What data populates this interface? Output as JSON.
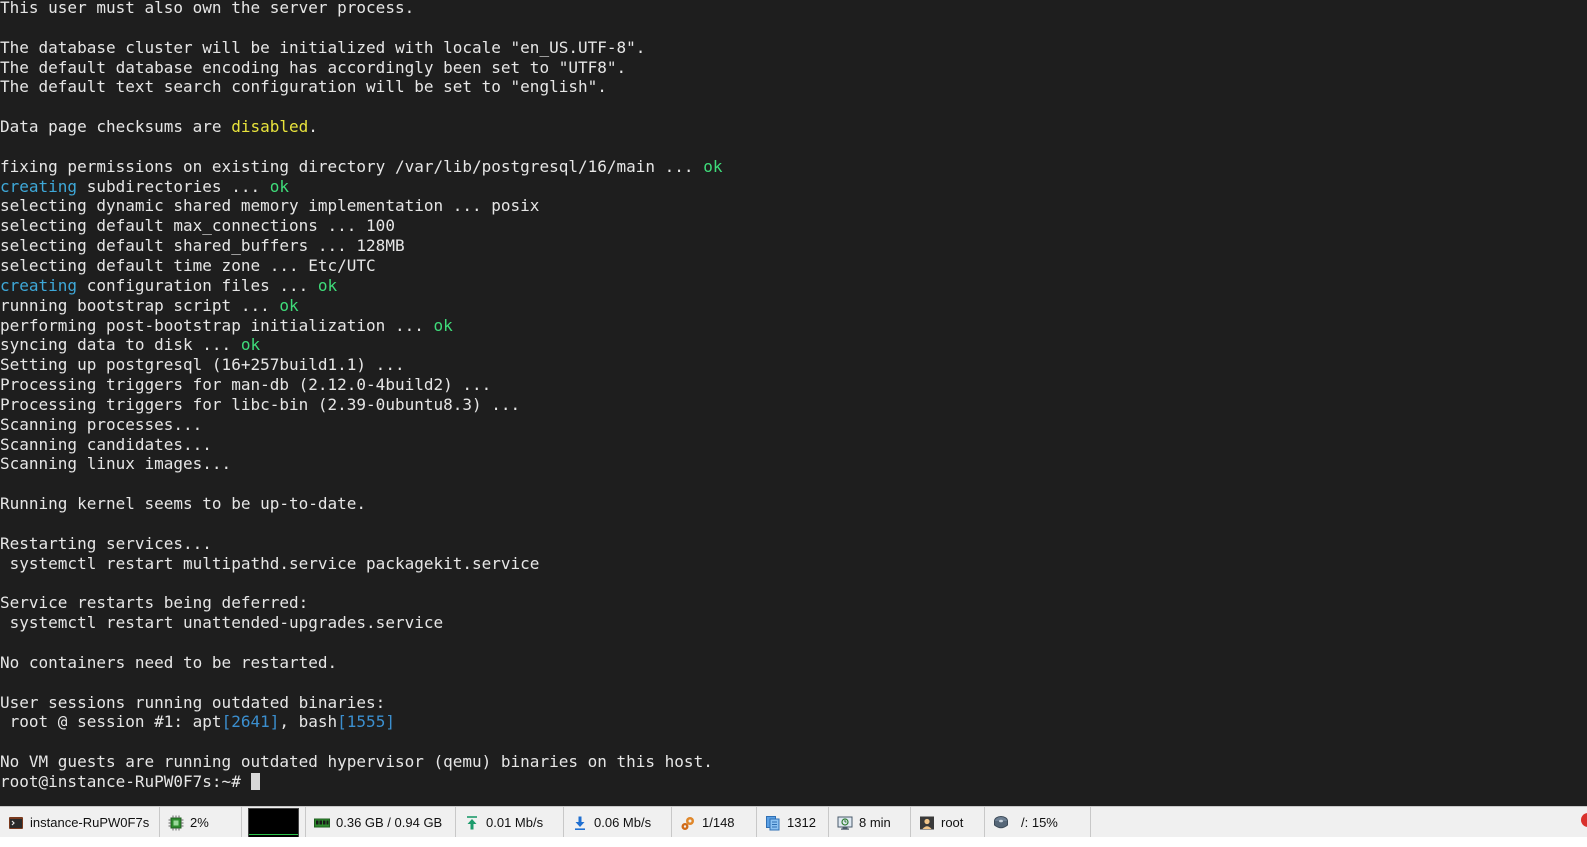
{
  "terminal": {
    "lines": [
      [
        {
          "t": "This user must also own the server process."
        }
      ],
      [
        {
          "t": ""
        }
      ],
      [
        {
          "t": "The database cluster will be initialized with locale \"en_US.UTF-8\"."
        }
      ],
      [
        {
          "t": "The default database encoding has accordingly been set to \"UTF8\"."
        }
      ],
      [
        {
          "t": "The default text search configuration will be set to \"english\"."
        }
      ],
      [
        {
          "t": ""
        }
      ],
      [
        {
          "t": "Data page checksums are "
        },
        {
          "t": "disabled",
          "c": "yellow"
        },
        {
          "t": "."
        }
      ],
      [
        {
          "t": ""
        }
      ],
      [
        {
          "t": "fixing permissions on existing directory /var/lib/postgresql/16/main ... "
        },
        {
          "t": "ok",
          "c": "green"
        }
      ],
      [
        {
          "t": "creating",
          "c": "cyan"
        },
        {
          "t": " subdirectories ... "
        },
        {
          "t": "ok",
          "c": "green"
        }
      ],
      [
        {
          "t": "selecting dynamic shared memory implementation ... posix"
        }
      ],
      [
        {
          "t": "selecting default max_connections ... 100"
        }
      ],
      [
        {
          "t": "selecting default shared_buffers ... 128MB"
        }
      ],
      [
        {
          "t": "selecting default time zone ... Etc/UTC"
        }
      ],
      [
        {
          "t": "creating",
          "c": "cyan"
        },
        {
          "t": " configuration files ... "
        },
        {
          "t": "ok",
          "c": "green"
        }
      ],
      [
        {
          "t": "running bootstrap script ... "
        },
        {
          "t": "ok",
          "c": "green"
        }
      ],
      [
        {
          "t": "performing post-bootstrap initialization ... "
        },
        {
          "t": "ok",
          "c": "green"
        }
      ],
      [
        {
          "t": "syncing data to disk ... "
        },
        {
          "t": "ok",
          "c": "green"
        }
      ],
      [
        {
          "t": "Setting up postgresql (16+257build1.1) ..."
        }
      ],
      [
        {
          "t": "Processing triggers for man-db (2.12.0-4build2) ..."
        }
      ],
      [
        {
          "t": "Processing triggers for libc-bin (2.39-0ubuntu8.3) ..."
        }
      ],
      [
        {
          "t": "Scanning processes..."
        }
      ],
      [
        {
          "t": "Scanning candidates..."
        }
      ],
      [
        {
          "t": "Scanning linux images..."
        }
      ],
      [
        {
          "t": ""
        }
      ],
      [
        {
          "t": "Running kernel seems to be up-to-date."
        }
      ],
      [
        {
          "t": ""
        }
      ],
      [
        {
          "t": "Restarting services..."
        }
      ],
      [
        {
          "t": " systemctl restart multipathd.service packagekit.service"
        }
      ],
      [
        {
          "t": ""
        }
      ],
      [
        {
          "t": "Service restarts being deferred:"
        }
      ],
      [
        {
          "t": " systemctl restart unattended-upgrades.service"
        }
      ],
      [
        {
          "t": ""
        }
      ],
      [
        {
          "t": "No containers need to be restarted."
        }
      ],
      [
        {
          "t": ""
        }
      ],
      [
        {
          "t": "User sessions running outdated binaries:"
        }
      ],
      [
        {
          "t": " root @ session #1: apt"
        },
        {
          "t": "[2641]",
          "c": "blue"
        },
        {
          "t": ", bash"
        },
        {
          "t": "[1555]",
          "c": "blue"
        }
      ],
      [
        {
          "t": ""
        }
      ],
      [
        {
          "t": "No VM guests are running outdated hypervisor (qemu) binaries on this host."
        }
      ]
    ],
    "prompt": "root@instance-RuPW0F7s:~# "
  },
  "statusbar": {
    "host": "instance-RuPW0F7s",
    "cpu": "2%",
    "memory": "0.36 GB / 0.94 GB",
    "upload": "0.01 Mb/s",
    "download": "0.06 Mb/s",
    "processes": "1/148",
    "count": "1312",
    "uptime": "8 min",
    "user": "root",
    "disk": "/: 15%"
  },
  "colors": {
    "background": "#1e1e1e",
    "foreground": "#e6e6e6",
    "ok_green": "#3fdc7a",
    "creating_cyan": "#3ea8d8",
    "pid_blue": "#3b8fcf",
    "disabled_yellow": "#e8e33c"
  },
  "icons": {
    "host": "terminal-app-icon",
    "cpu": "cpu-chip-icon",
    "memory": "memory-stick-icon",
    "upload": "upload-arrow-icon",
    "download": "download-arrow-icon",
    "processes": "gears-icon",
    "count": "documents-icon",
    "uptime": "monitor-clock-icon",
    "user": "user-card-icon",
    "disk": "hard-disk-icon"
  }
}
